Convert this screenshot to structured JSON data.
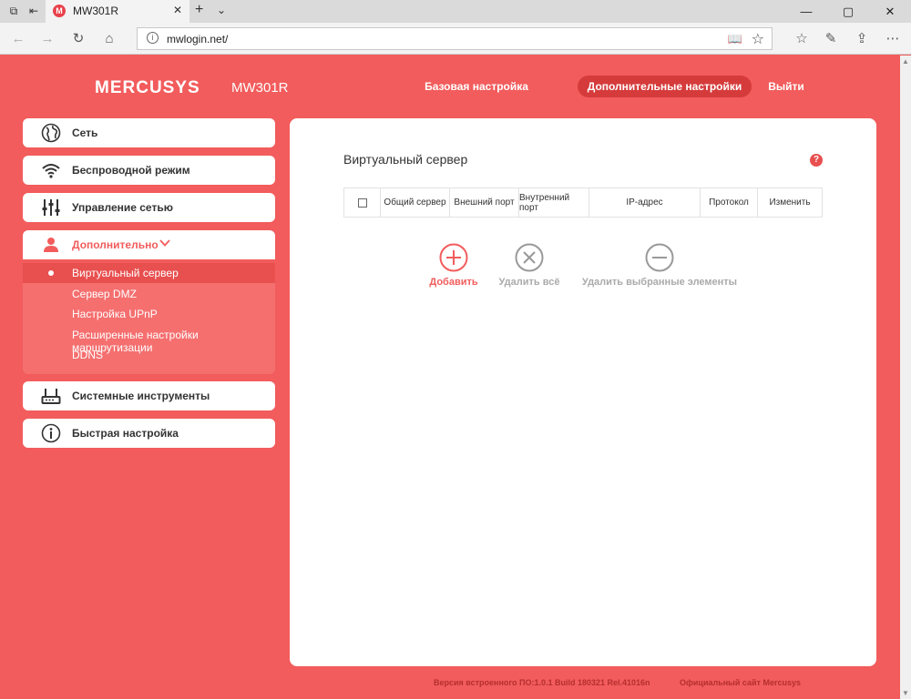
{
  "browser": {
    "tab_title": "MW301R",
    "favicon_letter": "M",
    "tab_close": "✕",
    "new_tab": "+",
    "address": "mwlogin.net/",
    "window_controls": [
      "—",
      "▢",
      "✕"
    ]
  },
  "header": {
    "brand": "MERCUSYS",
    "model": "MW301R",
    "nav": [
      {
        "label": "Базовая настройка",
        "active": false
      },
      {
        "label": "Дополнительные настройки",
        "active": true
      },
      {
        "label": "Выйти",
        "active": false
      }
    ]
  },
  "sidebar": {
    "items": [
      {
        "label": "Сеть",
        "icon": "globe-icon"
      },
      {
        "label": "Беспроводной режим",
        "icon": "wifi-icon"
      },
      {
        "label": "Управление сетью",
        "icon": "sliders-icon"
      },
      {
        "label": "Дополнительно",
        "icon": "user-icon"
      },
      {
        "label": "Системные инструменты",
        "icon": "router-icon"
      },
      {
        "label": "Быстрая настройка",
        "icon": "info-icon"
      }
    ],
    "submenu": [
      {
        "label": "Виртуальный сервер",
        "active": true
      },
      {
        "label": "Сервер DMZ"
      },
      {
        "label": "Настройка UPnP"
      },
      {
        "label": "Расширенные настройки маршрутизации"
      },
      {
        "label": "DDNS"
      }
    ]
  },
  "main": {
    "title": "Виртуальный сервер",
    "help": "?",
    "columns": [
      "Общий сервер",
      "Внешний порт",
      "Внутренний порт",
      "IP-адрес",
      "Протокол",
      "Изменить"
    ],
    "actions": {
      "add": "Добавить",
      "delete_all": "Удалить всё",
      "delete_selected": "Удалить выбранные элементы"
    }
  },
  "footer": {
    "firmware": "Версия встроенного ПО:1.0.1 Build 180321 Rel.41016n",
    "official_site": "Официальный сайт Mercusys"
  },
  "colors": {
    "accent": "#f25c5c",
    "accent_dark": "#d63b3b",
    "submenu_bg": "#f56f6f",
    "footer_text": "#b52e2e"
  }
}
